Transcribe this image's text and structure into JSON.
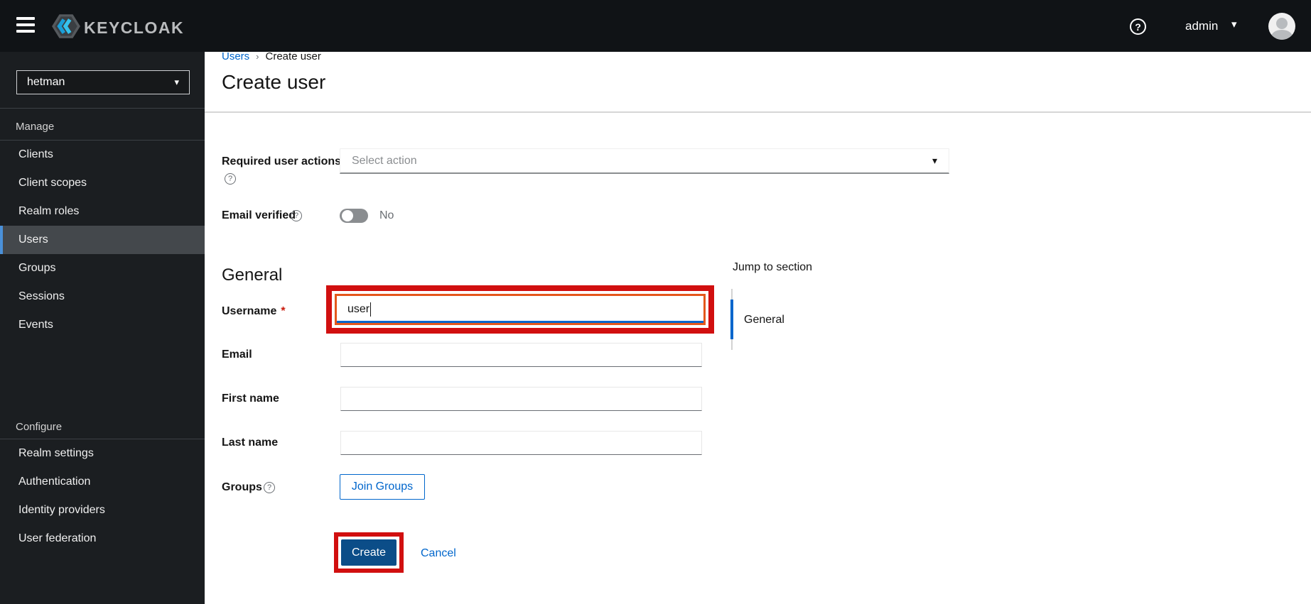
{
  "header": {
    "brand": "KEYCLOAK",
    "help_icon": "?",
    "user_menu": "admin",
    "caret_icon": "▾"
  },
  "sidebar": {
    "realm": "hetman",
    "realm_caret": "▾",
    "manage_label": "Manage",
    "manage_items": [
      "Clients",
      "Client scopes",
      "Realm roles",
      "Users",
      "Groups",
      "Sessions",
      "Events"
    ],
    "active_item": "Users",
    "configure_label": "Configure",
    "configure_items": [
      "Realm settings",
      "Authentication",
      "Identity providers",
      "User federation"
    ]
  },
  "breadcrumb": {
    "parent": "Users",
    "separator": "›",
    "current": "Create user"
  },
  "page_title": "Create user",
  "form": {
    "required_user_actions": {
      "label": "Required user actions",
      "placeholder": "Select action",
      "caret": "▾",
      "help_icon": "?"
    },
    "email_verified": {
      "label": "Email verified",
      "state": "No",
      "help_icon": "?"
    },
    "general_section": "General",
    "username": {
      "label": "Username",
      "required_marker": "*",
      "value": "user"
    },
    "email": {
      "label": "Email",
      "value": ""
    },
    "first_name": {
      "label": "First name",
      "value": ""
    },
    "last_name": {
      "label": "Last name",
      "value": ""
    },
    "groups": {
      "label": "Groups",
      "button": "Join Groups",
      "help_icon": "?"
    },
    "actions": {
      "create": "Create",
      "cancel": "Cancel"
    }
  },
  "jump_nav": {
    "title": "Jump to section",
    "items": [
      "General"
    ]
  },
  "colors": {
    "accent_blue": "#0066cc",
    "primary_button": "#0b4d88",
    "annotation_red": "#d10f0f",
    "annotation_orange": "#e4571c",
    "sidebar_active_bar": "#4a90d9"
  }
}
